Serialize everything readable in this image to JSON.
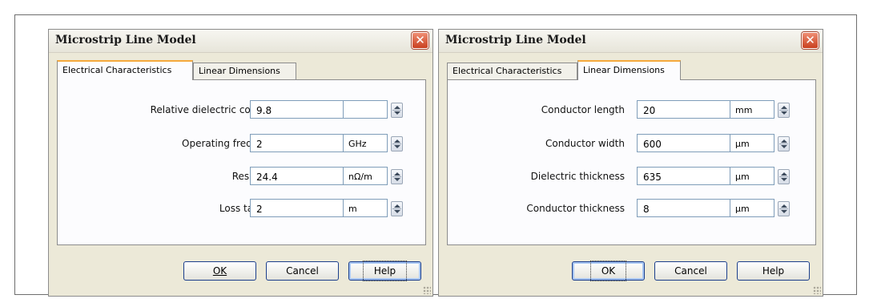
{
  "dialogs": [
    {
      "title": "Microstrip Line Model",
      "tabs": [
        "Electrical Characteristics",
        "Linear Dimensions"
      ],
      "active_tab": "Electrical Characteristics",
      "fields": [
        {
          "label": "Relative dielectric constant",
          "value": "9.8",
          "unit": ""
        },
        {
          "label": "Operating frequency",
          "value": "2",
          "unit": "GHz"
        },
        {
          "label": "Resistivity",
          "value": "24.4",
          "unit": "nΩ/m"
        },
        {
          "label": "Loss tangent",
          "value": "2",
          "unit": "m"
        }
      ],
      "buttons": {
        "ok": "OK",
        "cancel": "Cancel",
        "help": "Help"
      },
      "focused_button": "Help"
    },
    {
      "title": "Microstrip Line Model",
      "tabs": [
        "Electrical Characteristics",
        "Linear Dimensions"
      ],
      "active_tab": "Linear Dimensions",
      "fields": [
        {
          "label": "Conductor length",
          "value": "20",
          "unit": "mm"
        },
        {
          "label": "Conductor width",
          "value": "600",
          "unit": "µm"
        },
        {
          "label": "Dielectric thickness",
          "value": "635",
          "unit": "µm"
        },
        {
          "label": "Conductor thickness",
          "value": "8",
          "unit": "µm"
        }
      ],
      "buttons": {
        "ok": "OK",
        "cancel": "Cancel",
        "help": "Help"
      },
      "focused_button": "OK"
    }
  ],
  "icons": {
    "close": "close-icon",
    "spinner": "spin-arrows-icon",
    "resize": "resize-grip-icon"
  },
  "colors": {
    "tab_accent": "#f5a93c",
    "close_button": "#c9401f",
    "dialog_bg": "#ece9d8",
    "field_border": "#7f9db9"
  }
}
